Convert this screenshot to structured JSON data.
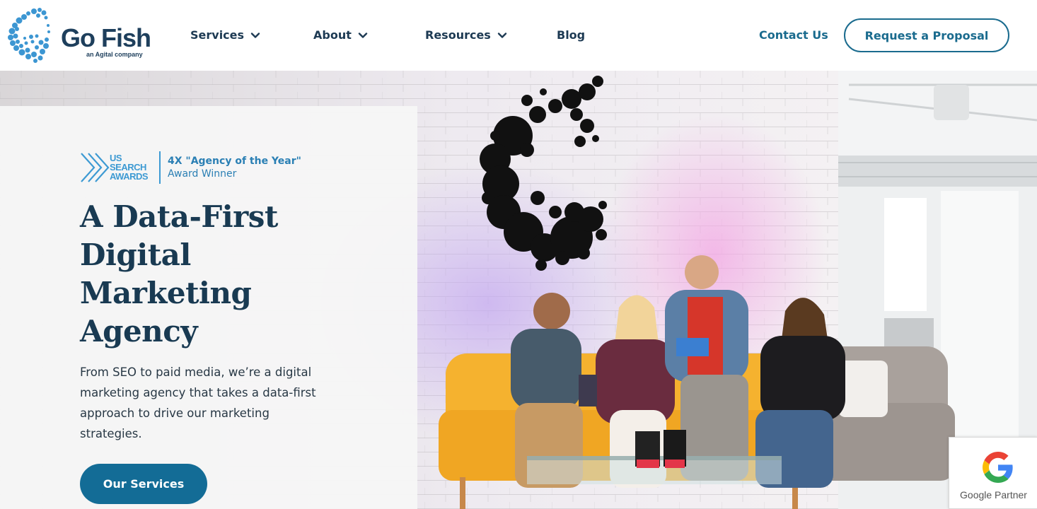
{
  "header": {
    "logo": {
      "wordmark": "Go Fish",
      "subtitle": "an Agital company",
      "icon": "go-fish-logo-icon"
    },
    "nav": [
      {
        "label": "Services",
        "has_dropdown": true,
        "icon": "chevron-down-icon"
      },
      {
        "label": "About",
        "has_dropdown": true,
        "icon": "chevron-down-icon"
      },
      {
        "label": "Resources",
        "has_dropdown": true,
        "icon": "chevron-down-icon"
      },
      {
        "label": "Blog",
        "has_dropdown": false
      }
    ],
    "contact_label": "Contact Us",
    "proposal_label": "Request a Proposal"
  },
  "hero": {
    "award": {
      "logo_text": [
        "US",
        "SEARCH",
        "AWARDS"
      ],
      "line1": "4X \"Agency of the Year\"",
      "line2": "Award Winner"
    },
    "headline": [
      "A Data-First",
      "Digital",
      "Marketing",
      "Agency"
    ],
    "subtext": "From SEO to paid media, we’re a digital marketing agency that takes a data-first approach to drive our marketing strategies.",
    "cta_label": "Our Services",
    "google_badge": {
      "label": "Google Partner",
      "icon": "google-g-icon"
    }
  },
  "colors": {
    "brand_navy": "#1e3f5c",
    "brand_teal": "#1a6b8e",
    "cta_blue": "#136c96",
    "award_blue": "#3d9ad3",
    "panel_bg": "#f6f6f6"
  }
}
